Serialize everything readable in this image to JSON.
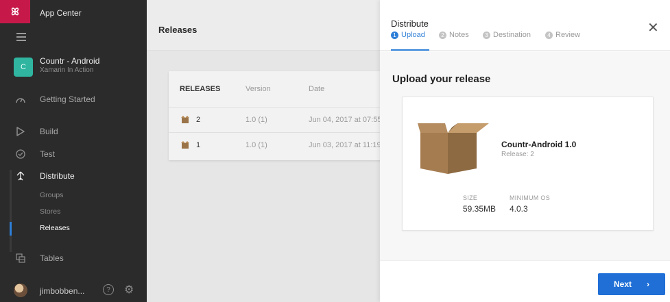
{
  "sidebar": {
    "logo_glyph": "ꕤ",
    "app_center_label": "App Center",
    "app": {
      "initial": "C",
      "name": "Countr - Android",
      "org": "Xamarin In Action"
    },
    "items": [
      {
        "label": "Getting Started",
        "icon": "gauge-icon"
      },
      {
        "label": "Build",
        "icon": "play-icon"
      },
      {
        "label": "Test",
        "icon": "check-circle-icon"
      },
      {
        "label": "Distribute",
        "icon": "distribute-icon"
      },
      {
        "label": "Tables",
        "icon": "tables-icon"
      }
    ],
    "distribute_sub": [
      {
        "label": "Groups"
      },
      {
        "label": "Stores"
      },
      {
        "label": "Releases"
      }
    ],
    "user": {
      "name": "jimbobben..."
    },
    "help_glyph": "?",
    "settings_glyph": "⚙"
  },
  "main": {
    "title": "Releases",
    "table": {
      "headers": [
        "RELEASES",
        "Version",
        "Date"
      ],
      "rows": [
        {
          "release": "2",
          "version": "1.0 (1)",
          "date": "Jun 04, 2017 at 07:55"
        },
        {
          "release": "1",
          "version": "1.0 (1)",
          "date": "Jun 03, 2017 at 11:19"
        }
      ]
    }
  },
  "panel": {
    "title": "Distribute",
    "close_glyph": "✕",
    "steps": [
      {
        "num": "1",
        "label": "Upload"
      },
      {
        "num": "2",
        "label": "Notes"
      },
      {
        "num": "3",
        "label": "Destination"
      },
      {
        "num": "4",
        "label": "Review"
      }
    ],
    "upload_title": "Upload your release",
    "release": {
      "name": "Countr-Android 1.0",
      "sub": "Release: 2",
      "size_label": "SIZE",
      "size_value": "59.35MB",
      "min_os_label": "MINIMUM OS",
      "min_os_value": "4.0.3"
    },
    "next_label": "Next",
    "next_chevron": "›"
  },
  "colors": {
    "sidebar_bg": "#2b2b2b",
    "logo_red": "#c6194a",
    "app_tile": "#2fb5a0",
    "accent_blue": "#2f7fd8",
    "next_button": "#1f6fd6"
  }
}
